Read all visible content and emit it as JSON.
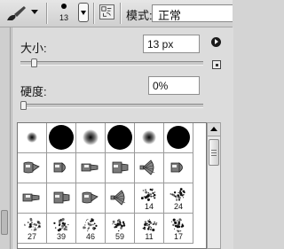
{
  "toolbar": {
    "tool_icon": "brush-icon",
    "brush_size_preview": "13",
    "mode_label": "模式:",
    "mode_value": "正常"
  },
  "panel": {
    "size_label": "大小:",
    "size_value": "13 px",
    "size_slider_fraction": 0.06,
    "hardness_label": "硬度:",
    "hardness_value": "0%",
    "hardness_slider_fraction": 0.0,
    "menu_icon": "panel-menu-arrow-icon",
    "save_icon": "new-preset-icon"
  },
  "presets": {
    "rows": [
      [
        {
          "kind": "soft",
          "size": 12,
          "label": ""
        },
        {
          "kind": "hard",
          "size": 28,
          "label": ""
        },
        {
          "kind": "soft",
          "size": 18,
          "label": ""
        },
        {
          "kind": "hard",
          "size": 28,
          "label": ""
        },
        {
          "kind": "soft",
          "size": 16,
          "label": ""
        },
        {
          "kind": "hard",
          "size": 26,
          "label": ""
        }
      ],
      [
        {
          "kind": "tip",
          "label": ""
        },
        {
          "kind": "tip",
          "label": ""
        },
        {
          "kind": "tip",
          "label": ""
        },
        {
          "kind": "tip",
          "label": ""
        },
        {
          "kind": "fan",
          "label": ""
        },
        {
          "kind": "tip",
          "label": ""
        }
      ],
      [
        {
          "kind": "tip",
          "label": ""
        },
        {
          "kind": "tip",
          "label": ""
        },
        {
          "kind": "tip",
          "label": ""
        },
        {
          "kind": "fan",
          "label": ""
        },
        {
          "kind": "splat",
          "label": "14"
        },
        {
          "kind": "splat",
          "label": "24"
        }
      ],
      [
        {
          "kind": "splat",
          "label": "27"
        },
        {
          "kind": "splat",
          "label": "39"
        },
        {
          "kind": "splat",
          "label": "46"
        },
        {
          "kind": "splat",
          "label": "59"
        },
        {
          "kind": "splat",
          "label": "11"
        },
        {
          "kind": "splat",
          "label": "17"
        }
      ]
    ]
  }
}
